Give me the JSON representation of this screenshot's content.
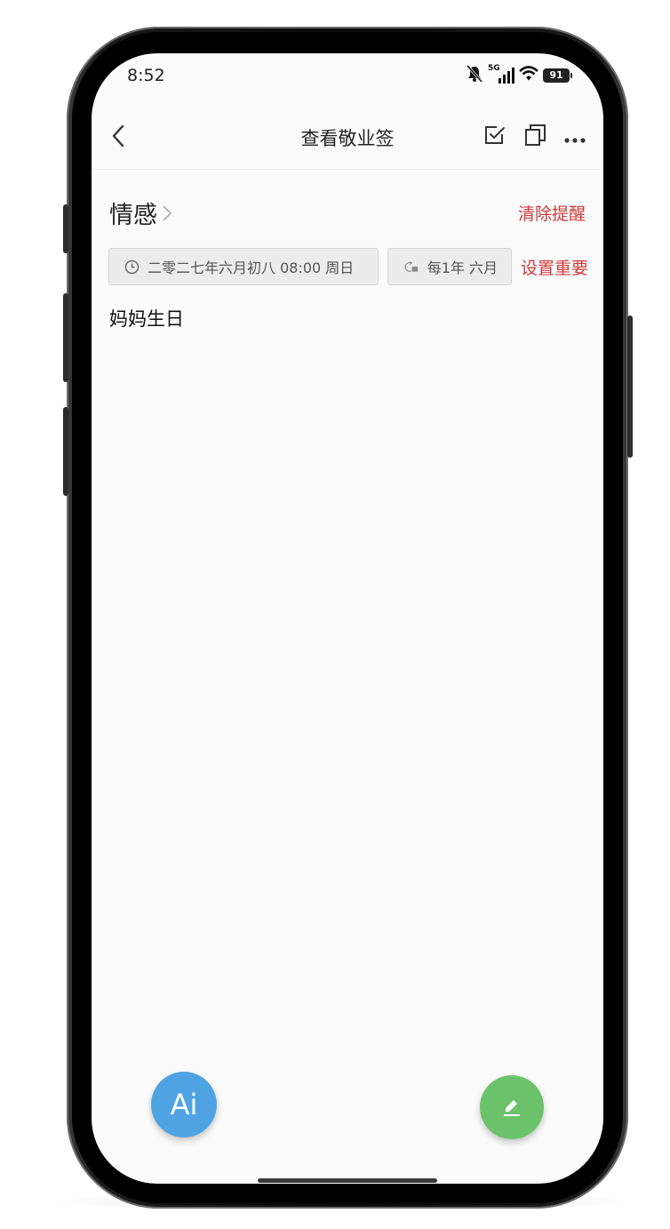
{
  "status_bar": {
    "time": "8:52",
    "network_label": "5G",
    "battery_level": "91"
  },
  "navbar": {
    "title": "查看敬业签"
  },
  "category": {
    "name": "情感"
  },
  "actions": {
    "clear_reminder": "清除提醒",
    "set_important": "设置重要"
  },
  "reminder": {
    "datetime": "二零二七年六月初八 08:00 周日",
    "repeat": "每1年 六月"
  },
  "note": {
    "content": "妈妈生日"
  },
  "fab": {
    "ai_label": "Ai"
  },
  "colors": {
    "accent_red": "#cf3b3b",
    "ai_blue": "#4fa3e3",
    "edit_green": "#6cc26a"
  }
}
